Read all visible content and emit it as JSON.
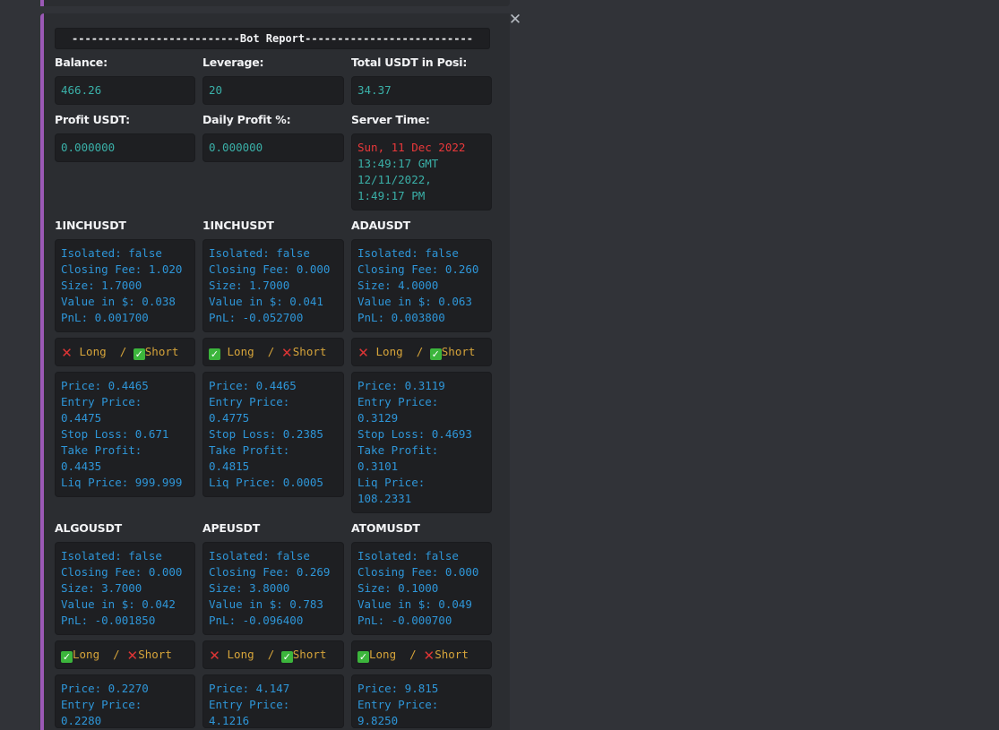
{
  "title": "--------------------------Bot Report--------------------------",
  "summary": [
    {
      "label": "Balance:",
      "value": "466.26"
    },
    {
      "label": "Leverage:",
      "value": "20"
    },
    {
      "label": "Total USDT in Posi:",
      "value": "34.37"
    },
    {
      "label": "Profit USDT:",
      "value": "0.000000"
    },
    {
      "label": "Daily Profit %:",
      "value": "0.000000"
    },
    {
      "label": "Server Time:",
      "lines": [
        "Sun, 11 Dec 2022",
        "13:49:17 GMT",
        "12/11/2022,",
        "1:49:17 PM"
      ]
    }
  ],
  "positions": [
    {
      "symbol": "1INCHUSDT",
      "isolated": "Isolated: false",
      "closing_fee": "Closing Fee: 1.020",
      "size": "Size: 1.7000",
      "value": "Value in $: 0.038",
      "pnl": "PnL: 0.001700",
      "long_icon": "x-icon",
      "long_label": "Long",
      "sep": "/",
      "short_icon": "check-icon",
      "short_label": "Short",
      "price": "Price: 0.4465",
      "entry_label": "Entry Price:",
      "entry_value": "0.4475",
      "stop_loss": "Stop Loss: 0.671",
      "tp_label": "Take Profit:",
      "tp_value": "0.4435",
      "liq": "Liq Price: 999.999",
      "liq_value": ""
    },
    {
      "symbol": "1INCHUSDT",
      "isolated": "Isolated: false",
      "closing_fee": "Closing Fee: 0.000",
      "size": "Size: 1.7000",
      "value": "Value in $: 0.041",
      "pnl": "PnL: -0.052700",
      "long_icon": "check-icon",
      "long_label": "Long",
      "sep": "/",
      "short_icon": "x-icon",
      "short_label": "Short",
      "price": "Price: 0.4465",
      "entry_label": "Entry Price:",
      "entry_value": "0.4775",
      "stop_loss": "Stop Loss: 0.2385",
      "tp_label": "Take Profit:",
      "tp_value": "0.4815",
      "liq": "Liq Price: 0.0005",
      "liq_value": ""
    },
    {
      "symbol": "ADAUSDT",
      "isolated": "Isolated: false",
      "closing_fee": "Closing Fee: 0.260",
      "size": "Size: 4.0000",
      "value": "Value in $: 0.063",
      "pnl": "PnL: 0.003800",
      "long_icon": "x-icon",
      "long_label": "Long",
      "sep": "/",
      "short_icon": "check-icon",
      "short_label": "Short",
      "price": "Price: 0.3119",
      "entry_label": "Entry Price:",
      "entry_value": "0.3129",
      "stop_loss": "Stop Loss: 0.4693",
      "tp_label": "Take Profit:",
      "tp_value": "0.3101",
      "liq": "Liq Price:",
      "liq_value": "108.2331"
    },
    {
      "symbol": "ALGOUSDT",
      "isolated": "Isolated: false",
      "closing_fee": "Closing Fee: 0.000",
      "size": "Size: 3.7000",
      "value": "Value in $: 0.042",
      "pnl": "PnL: -0.001850",
      "long_icon": "check-icon",
      "long_label": "Long",
      "sep": "/",
      "short_icon": "x-icon",
      "short_label": "Short",
      "price": "Price: 0.2270",
      "entry_label": "Entry Price:",
      "entry_value": "0.2280"
    },
    {
      "symbol": "APEUSDT",
      "isolated": "Isolated: false",
      "closing_fee": "Closing Fee: 0.269",
      "size": "Size: 3.8000",
      "value": "Value in $: 0.783",
      "pnl": "PnL: -0.096400",
      "long_icon": "x-icon",
      "long_label": "Long",
      "sep": "/",
      "short_icon": "check-icon",
      "short_label": "Short",
      "price": "Price: 4.147",
      "entry_label": "Entry Price:",
      "entry_value": "4.1216"
    },
    {
      "symbol": "ATOMUSDT",
      "isolated": "Isolated: false",
      "closing_fee": "Closing Fee: 0.000",
      "size": "Size: 0.1000",
      "value": "Value in $: 0.049",
      "pnl": "PnL: -0.000700",
      "long_icon": "check-icon",
      "long_label": "Long",
      "sep": "/",
      "short_icon": "x-icon",
      "short_label": "Short",
      "price": "Price: 9.815",
      "entry_label": "Entry Price:",
      "entry_value": "9.8250"
    }
  ],
  "colors": {
    "embed_accent": "#9b59b6",
    "mono_green": "#3ab0a8",
    "mono_blue": "#2e96d8",
    "long_short": "#d6a43a",
    "cross": "#dd3535",
    "check": "#3cb53c"
  }
}
